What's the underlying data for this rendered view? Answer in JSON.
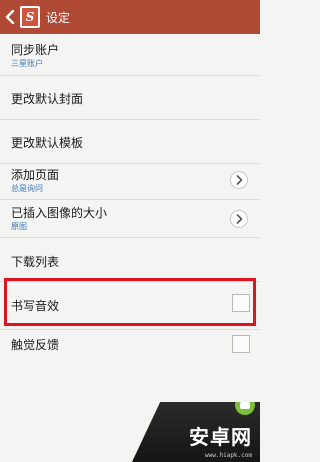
{
  "header": {
    "title": "设定",
    "app_logo_text": "S"
  },
  "settings": [
    {
      "label": "同步账户",
      "sub": "三星账户",
      "control": "none"
    },
    {
      "label": "更改默认封面",
      "sub": "",
      "control": "none"
    },
    {
      "label": "更改默认模板",
      "sub": "",
      "control": "none"
    },
    {
      "label": "添加页面",
      "sub": "总是询问",
      "control": "chevron"
    },
    {
      "label": "已插入图像的大小",
      "sub": "原图",
      "control": "chevron"
    },
    {
      "label": "下载列表",
      "sub": "",
      "control": "none"
    },
    {
      "label": "书写音效",
      "sub": "",
      "control": "checkbox",
      "checked": false
    },
    {
      "label": "触觉反馈",
      "sub": "",
      "control": "checkbox",
      "checked": false
    }
  ],
  "watermark": {
    "text": "安卓网",
    "url": "www.hiapk.com"
  },
  "colors": {
    "action_bar": "#b04a34",
    "subtext": "#3a7bbf",
    "highlight": "#e0141e"
  }
}
